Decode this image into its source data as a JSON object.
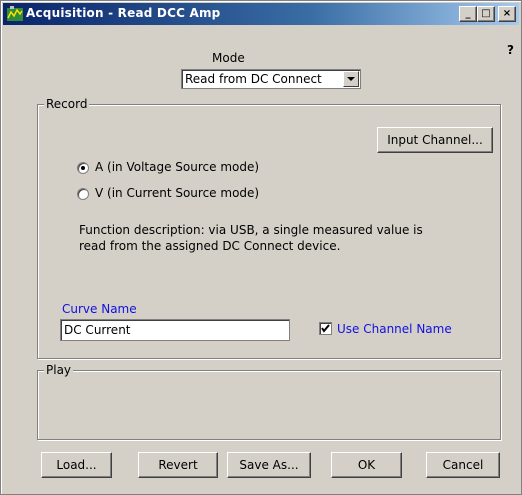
{
  "window": {
    "title": "Acquisition - Read DCC Amp",
    "minimize_glyph": "_",
    "maximize_glyph": "□",
    "close_glyph": "×",
    "help_glyph": "?"
  },
  "mode": {
    "label": "Mode",
    "selected": "Read from DC Connect"
  },
  "record": {
    "title": "Record",
    "input_channel_button": "Input Channel...",
    "radio_a_label": "A (in Voltage Source mode)",
    "radio_v_label": "V (in Current Source mode)",
    "radio_selected": "A",
    "description_line1": "Function description: via USB, a single measured value is",
    "description_line2": "read from the assigned DC Connect device.",
    "curve_name_label": "Curve Name",
    "curve_name_value": "DC Current",
    "use_channel_name_label": "Use Channel Name",
    "use_channel_name_checked": true
  },
  "play": {
    "title": "Play"
  },
  "buttons": {
    "load": "Load...",
    "revert": "Revert",
    "save_as": "Save As...",
    "ok": "OK",
    "cancel": "Cancel"
  },
  "colors": {
    "accent_blue": "#1010e0",
    "title_bar": "#0a246a",
    "dialog_face": "#d4d0c8"
  }
}
